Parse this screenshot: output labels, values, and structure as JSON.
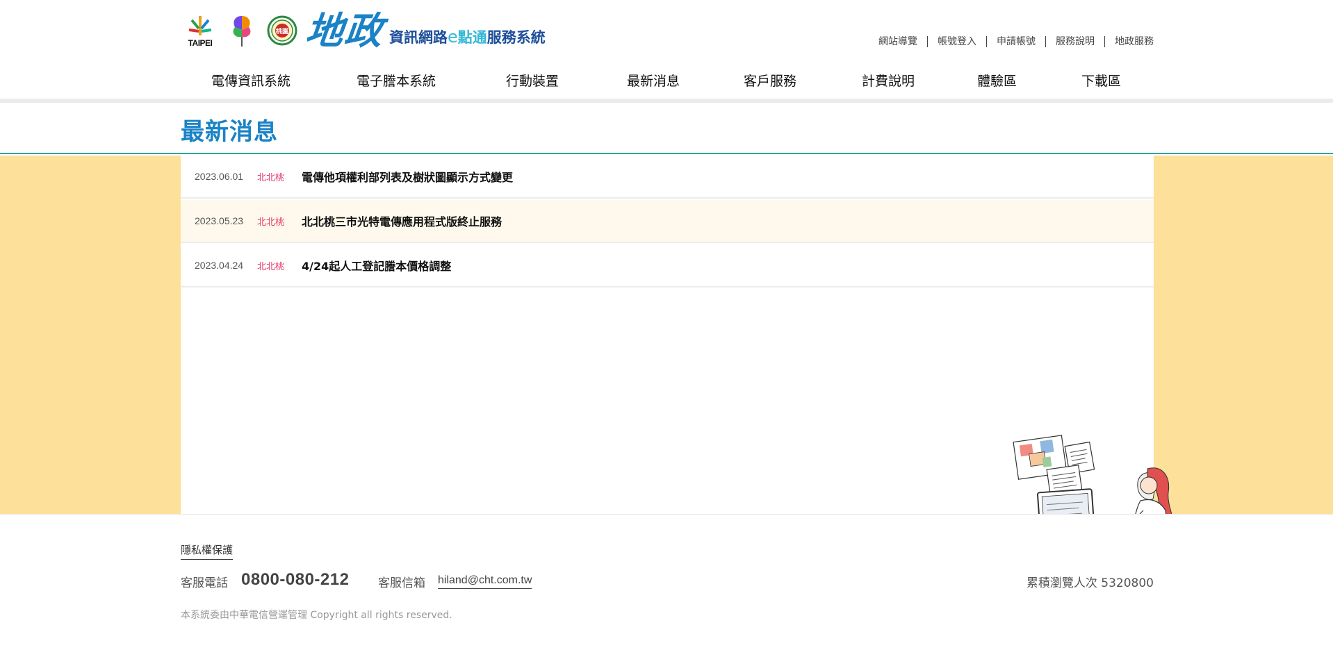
{
  "header": {
    "logos": {
      "taipei_text": "TAIPEI",
      "taoyuan_text": "桃園"
    },
    "brand": {
      "big": "地政",
      "sub_part1": "資訊網路",
      "sub_e": "e",
      "sub_part2": "點通",
      "sub_part3": "服務系統"
    },
    "top_links": [
      {
        "label": "網站導覽"
      },
      {
        "label": "帳號登入"
      },
      {
        "label": "申請帳號"
      },
      {
        "label": "服務說明"
      },
      {
        "label": "地政服務"
      }
    ],
    "nav": [
      {
        "label": "電傳資訊系統"
      },
      {
        "label": "電子謄本系統"
      },
      {
        "label": "行動裝置"
      },
      {
        "label": "最新消息"
      },
      {
        "label": "客戶服務"
      },
      {
        "label": "計費說明"
      },
      {
        "label": "體驗區"
      },
      {
        "label": "下載區"
      }
    ]
  },
  "page_title": "最新消息",
  "news": [
    {
      "date": "2023.06.01",
      "tag": "北北桃",
      "title": "電傳他項權利部列表及樹狀圖顯示方式變更"
    },
    {
      "date": "2023.05.23",
      "tag": "北北桃",
      "title": "北北桃三市光特電傳應用程式版終止服務"
    },
    {
      "date": "2023.04.24",
      "tag": "北北桃",
      "title": "4/24起人工登記謄本價格調整"
    }
  ],
  "footer": {
    "privacy": "隱私權保護",
    "phone_label": "客服電話",
    "phone": "0800-080-212",
    "mail_label": "客服信箱",
    "mail": "hiland@cht.com.tw",
    "visits": "累積瀏覽人次 5320800",
    "copyright": "本系統委由中華電信營運管理 Copyright all rights reserved."
  },
  "colors": {
    "accent_blue": "#1a82c6",
    "brand_navy": "#1d4f9a",
    "tag_pink": "#e53c6e",
    "content_bg": "#fde19a",
    "divider_teal": "#2aa6a0"
  }
}
